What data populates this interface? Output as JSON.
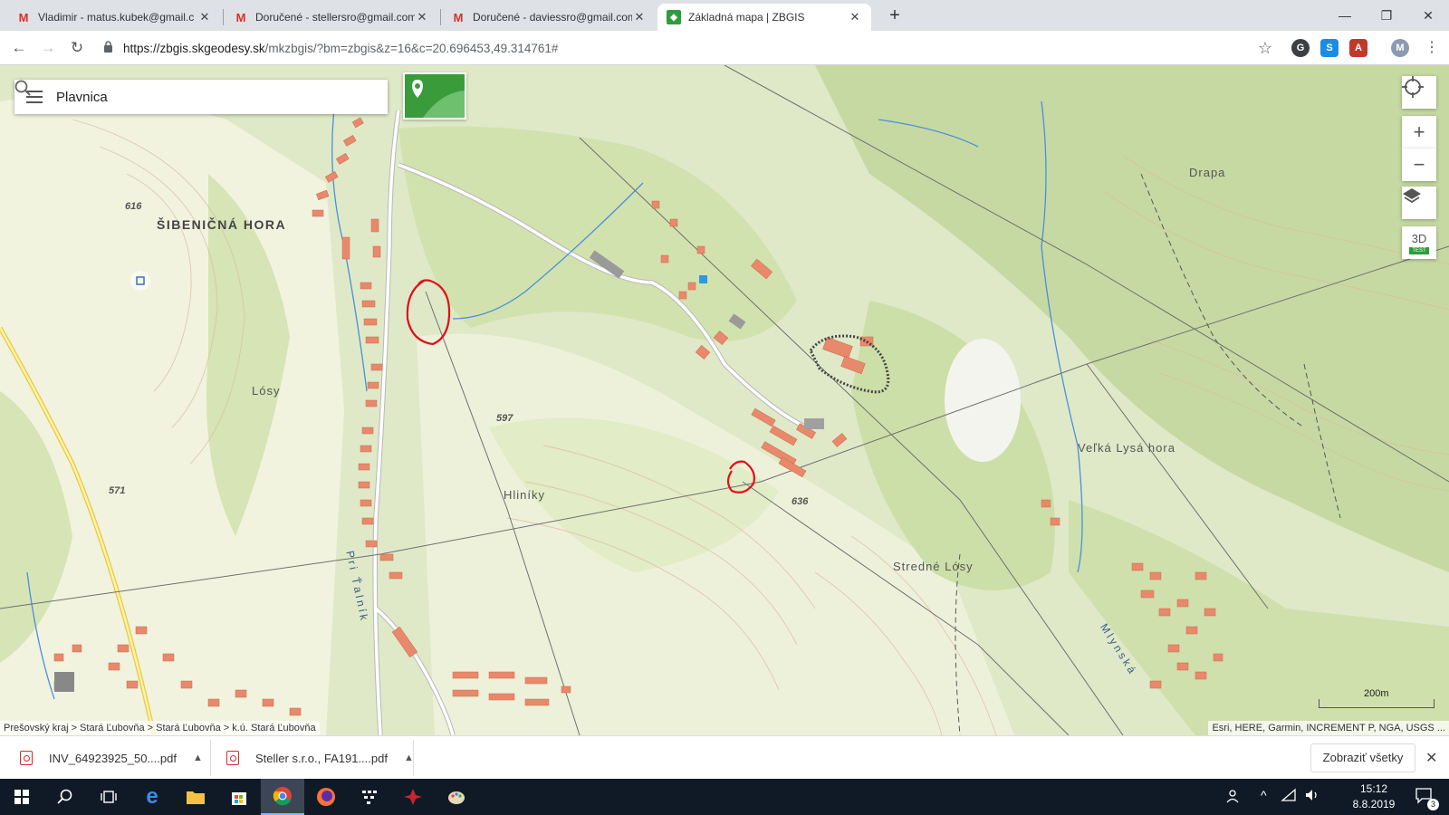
{
  "browser": {
    "tabs": [
      {
        "title": "Vladimir - matus.kubek@gmail.c",
        "icon": "gmail-icon",
        "active": false
      },
      {
        "title": "Doručené - stellersro@gmail.com",
        "icon": "gmail-icon",
        "active": false
      },
      {
        "title": "Doručené - daviessro@gmail.com",
        "icon": "gmail-icon",
        "active": false
      },
      {
        "title": "Základná mapa | ZBGIS",
        "icon": "zbgis-icon",
        "active": true
      }
    ],
    "url_host": "https://zbgis.skgeodesy.sk",
    "url_path": "/mkzbgis/?bm=zbgis&z=16&c=20.696453,49.314761#",
    "profile_initial": "M"
  },
  "map": {
    "search_value": "Plavnica",
    "zoom_in": "+",
    "zoom_out": "−",
    "btn_3d": "3D",
    "btn_3d_badge": "TEST",
    "labels": {
      "sibenicna_hora": "ŠIBENIČNÁ HORA",
      "losy": "Lósy",
      "hliniky": "Hliníky",
      "drapa": "Drapa",
      "velka_lysa_hora": "Veľká Lysá hora",
      "stredne_losy": "Stredné Lósy",
      "pod_vrchom": "Pri Ťalník",
      "e616": "616",
      "e571": "571",
      "e597": "597",
      "e636": "636",
      "mlynska": "Mlynská"
    },
    "breadcrumb": "Prešovský kraj  >  Stará Ľubovňa  >  Stará Ľubovňa  >  k.ú. Stará Ľubovňa",
    "attribution": "Esri, HERE, Garmin, INCREMENT P, NGA, USGS ...",
    "scale_label": "200m"
  },
  "downloads": {
    "items": [
      {
        "name": "INV_64923925_50....pdf"
      },
      {
        "name": "Steller s.r.o., FA191....pdf"
      }
    ],
    "show_all": "Zobraziť všetky"
  },
  "taskbar": {
    "time": "15:12",
    "date": "8.8.2019",
    "notification_count": "3"
  },
  "colors": {
    "map_base": "#dfe9c8",
    "forest": "#c9dba6",
    "building": "#e8896b",
    "annotation_red": "#e0101a",
    "taskbar": "#101a27"
  }
}
